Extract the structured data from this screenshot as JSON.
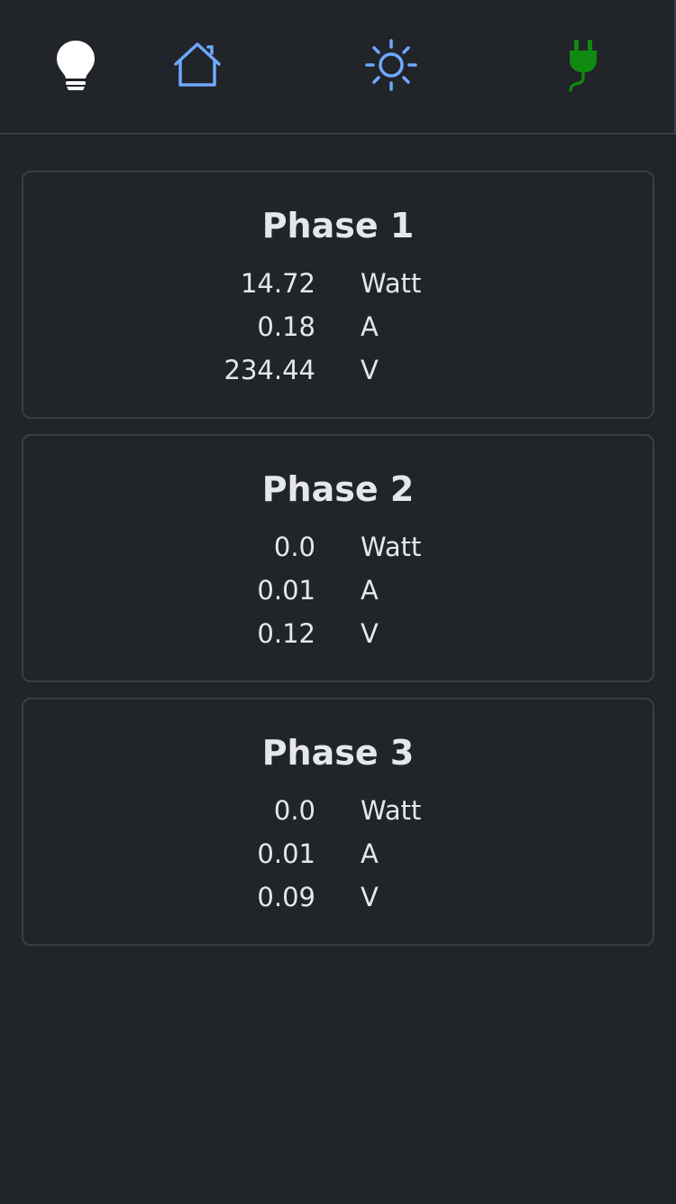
{
  "nav": {
    "items": [
      {
        "icon": "lightbulb-icon",
        "color": "#ffffff"
      },
      {
        "icon": "home-icon",
        "color": "#6ea8fe"
      },
      {
        "icon": "sun-icon",
        "color": "#6ea8fe"
      },
      {
        "icon": "power-plug-icon",
        "color": "#118a11"
      }
    ]
  },
  "phases": [
    {
      "title": "Phase 1",
      "readings": [
        {
          "value": "14.72",
          "unit": "Watt"
        },
        {
          "value": "0.18",
          "unit": "A"
        },
        {
          "value": "234.44",
          "unit": "V"
        }
      ]
    },
    {
      "title": "Phase 2",
      "readings": [
        {
          "value": "0.0",
          "unit": "Watt"
        },
        {
          "value": "0.01",
          "unit": "A"
        },
        {
          "value": "0.12",
          "unit": "V"
        }
      ]
    },
    {
      "title": "Phase 3",
      "readings": [
        {
          "value": "0.0",
          "unit": "Watt"
        },
        {
          "value": "0.01",
          "unit": "A"
        },
        {
          "value": "0.09",
          "unit": "V"
        }
      ]
    }
  ]
}
